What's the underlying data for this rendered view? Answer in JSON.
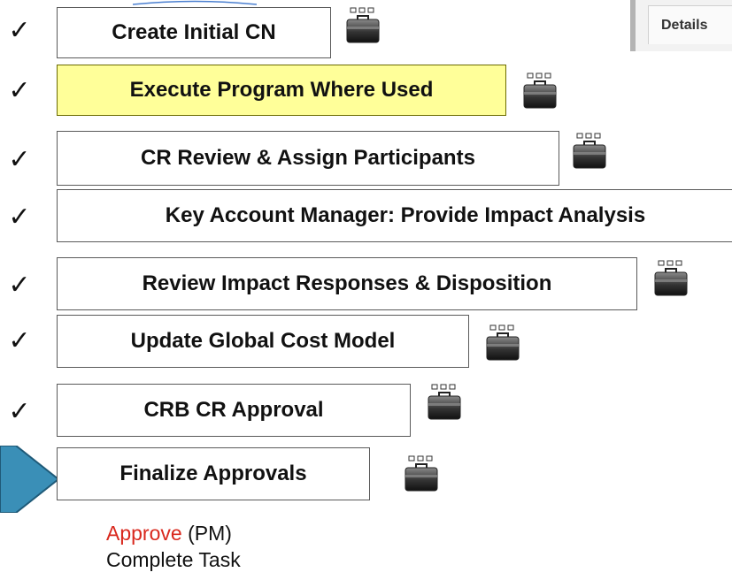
{
  "tasks": [
    {
      "label": "Create Initial CN",
      "status": "check-icon"
    },
    {
      "label": "Execute Program Where Used",
      "status": "check-icon",
      "highlight": "#ffff99"
    },
    {
      "label": "CR Review & Assign Participants",
      "status": "check-icon"
    },
    {
      "label": "Key Account Manager: Provide Impact Analysis",
      "status": "check-icon"
    },
    {
      "label": "Review Impact Responses & Disposition",
      "status": "check-icon"
    },
    {
      "label": "Update Global Cost Model",
      "status": "check-icon"
    },
    {
      "label": "CRB CR Approval",
      "status": "check-icon"
    },
    {
      "label": "Finalize Approvals",
      "status": "current-step-arrow-icon"
    }
  ],
  "check_glyph": "✓",
  "details_tab": {
    "label": "Details"
  },
  "actions": {
    "approve_word": "Approve",
    "approve_role": "(PM)",
    "complete": "Complete Task"
  },
  "colors": {
    "arrow_fill": "#3a8fb7",
    "approve_text": "#d9281d",
    "active_task_bg": "#ffff99"
  }
}
